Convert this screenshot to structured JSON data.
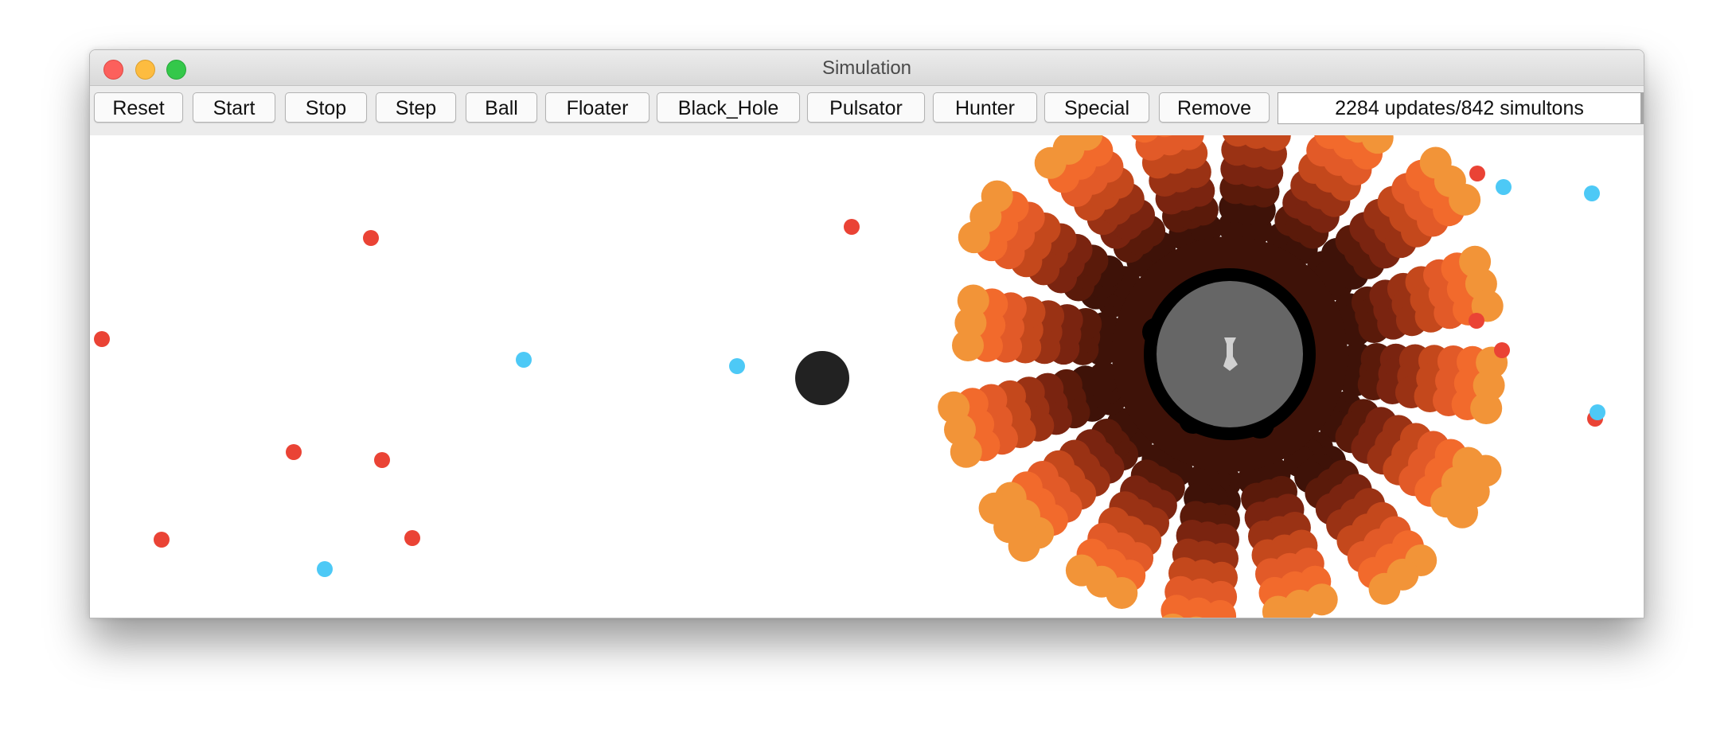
{
  "window": {
    "title": "Simulation"
  },
  "toolbar": {
    "buttons": [
      "Reset",
      "Start",
      "Stop",
      "Step",
      "Ball",
      "Floater",
      "Black_Hole",
      "Pulsator",
      "Hunter",
      "Special",
      "Remove"
    ],
    "status": "2284 updates/842 simultons"
  },
  "colors": {
    "ball": "#ea4335",
    "floater": "#4dc9f6",
    "black_hole": "#222222",
    "pulsator_light": "#f08c30",
    "pulsator_dark": "#3e1208",
    "window_chrome": "#ececec"
  }
}
